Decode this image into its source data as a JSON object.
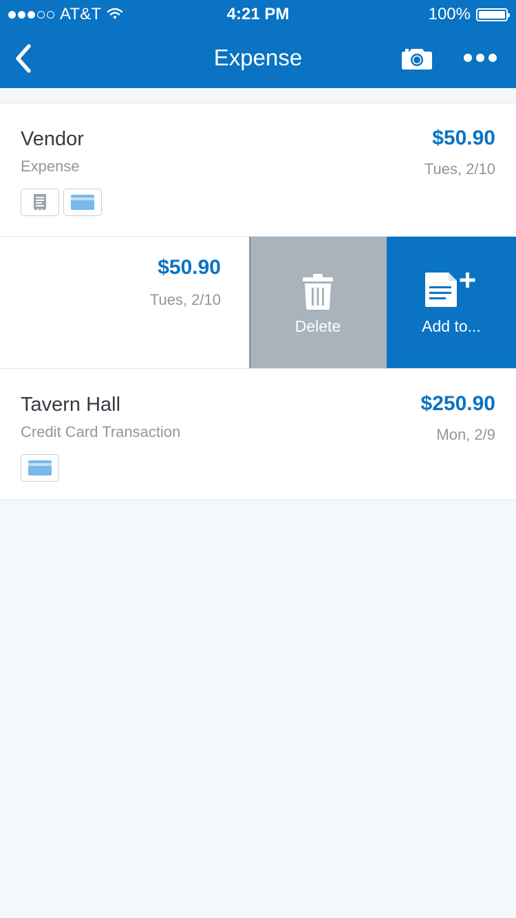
{
  "status_bar": {
    "carrier": "AT&T",
    "time": "4:21 PM",
    "battery": "100%",
    "signal_bars_filled": 3,
    "signal_bars_total": 5
  },
  "nav": {
    "title": "Expense",
    "back_icon": "chevron-left-icon",
    "camera_icon": "camera-icon",
    "more_icon": "more-dots-icon"
  },
  "transactions": [
    {
      "vendor": "Vendor",
      "kind": "Expense",
      "amount": "$50.90",
      "date": "Tues, 2/10",
      "badges": [
        "receipt-icon",
        "credit-card-icon"
      ]
    },
    {
      "amount": "$50.90",
      "date": "Tues, 2/10"
    },
    {
      "vendor": "Tavern Hall",
      "kind": "Credit Card Transaction",
      "amount": "$250.90",
      "date": "Mon, 2/9",
      "badges": [
        "credit-card-icon"
      ]
    }
  ],
  "swipe_actions": {
    "delete_label": "Delete",
    "add_label": "Add to..."
  },
  "colors": {
    "brand": "#0a73c4",
    "delete_action": "#a8b3bb",
    "background": "#f4f8fb",
    "text_primary": "#333a42",
    "text_secondary": "#8e979f",
    "card_icon": "#78b9e9",
    "receipt_icon": "#9aa4ac"
  }
}
